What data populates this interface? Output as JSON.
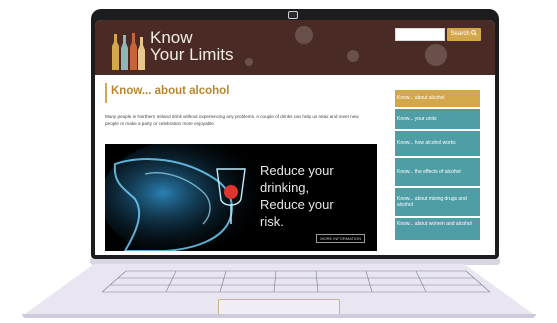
{
  "site": {
    "logo_line1": "Know",
    "logo_line2": "Your Limits",
    "search_label": "Search"
  },
  "page": {
    "heading": "Know... about alcohol",
    "intro": "Many people in Northern Ireland drink without experiencing any problems. A couple of drinks can help us relax and meet new people or make a party or celebration more enjoyable."
  },
  "hero": {
    "line1": "Reduce your",
    "line2": "drinking,",
    "line3": "Reduce your",
    "line4": "risk.",
    "more_label": "MORE INFORMATION"
  },
  "sidebar": {
    "items": [
      {
        "label": "Know... about alcohol",
        "active": true
      },
      {
        "label": "Know... your units",
        "active": false
      },
      {
        "label": "Know... how alcohol works",
        "active": false
      },
      {
        "label": "Know... the effects of alcohol",
        "active": false
      },
      {
        "label": "Know... about mixing drugs and alcohol",
        "active": false
      },
      {
        "label": "Know... about women and alcohol",
        "active": false
      }
    ]
  },
  "colors": {
    "header_bg": "#4a2a24",
    "accent_gold": "#d3a74c",
    "sidebar_teal": "#4f9ea6",
    "heading_text": "#b7882f"
  },
  "icons": [
    "search-icon",
    "camera-icon",
    "bottles-logo-icon"
  ]
}
